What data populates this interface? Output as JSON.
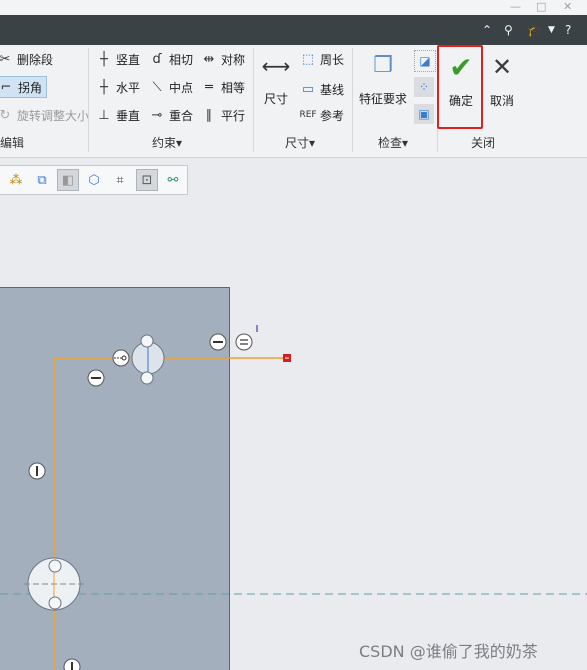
{
  "window_controls": {
    "minimize": "—",
    "maximize": "□",
    "close": "✕"
  },
  "titlebar_icons": [
    "caret-up-icon",
    "search-icon",
    "graduation-cap-icon",
    "dropdown-icon",
    "help-icon"
  ],
  "ribbon": {
    "edit": {
      "delete_segment": "删除段",
      "corner": "拐角",
      "rotate_resize": "旋转调整大小",
      "group_label": "编辑"
    },
    "constrain": {
      "vertical": "竖直",
      "tangent": "相切",
      "symmetric": "对称",
      "horizontal": "水平",
      "midpoint": "中点",
      "equal": "相等",
      "perpendicular": "垂直",
      "coincident": "重合",
      "parallel": "平行",
      "group_label": "约束▾"
    },
    "dimension": {
      "dimension": "尺寸",
      "perimeter": "周长",
      "baseline": "基线",
      "reference": "参考",
      "group_label": "尺寸▾"
    },
    "inspect": {
      "feature_requirements": "特征要求",
      "group_label": "检查▾"
    },
    "close": {
      "ok": "确定",
      "cancel": "取消",
      "group_label": "关闭"
    }
  },
  "watermark": "CSDN @谁偷了我的奶茶",
  "colors": {
    "titlebar": "#3b4246",
    "ribbon": "#f1f2f4",
    "sketch_line": "#f0a030",
    "highlight": "#e21f1f",
    "ok_check": "#3a9a2a",
    "canvas_plane": "#a3afbc",
    "background": "#e9ebee"
  }
}
